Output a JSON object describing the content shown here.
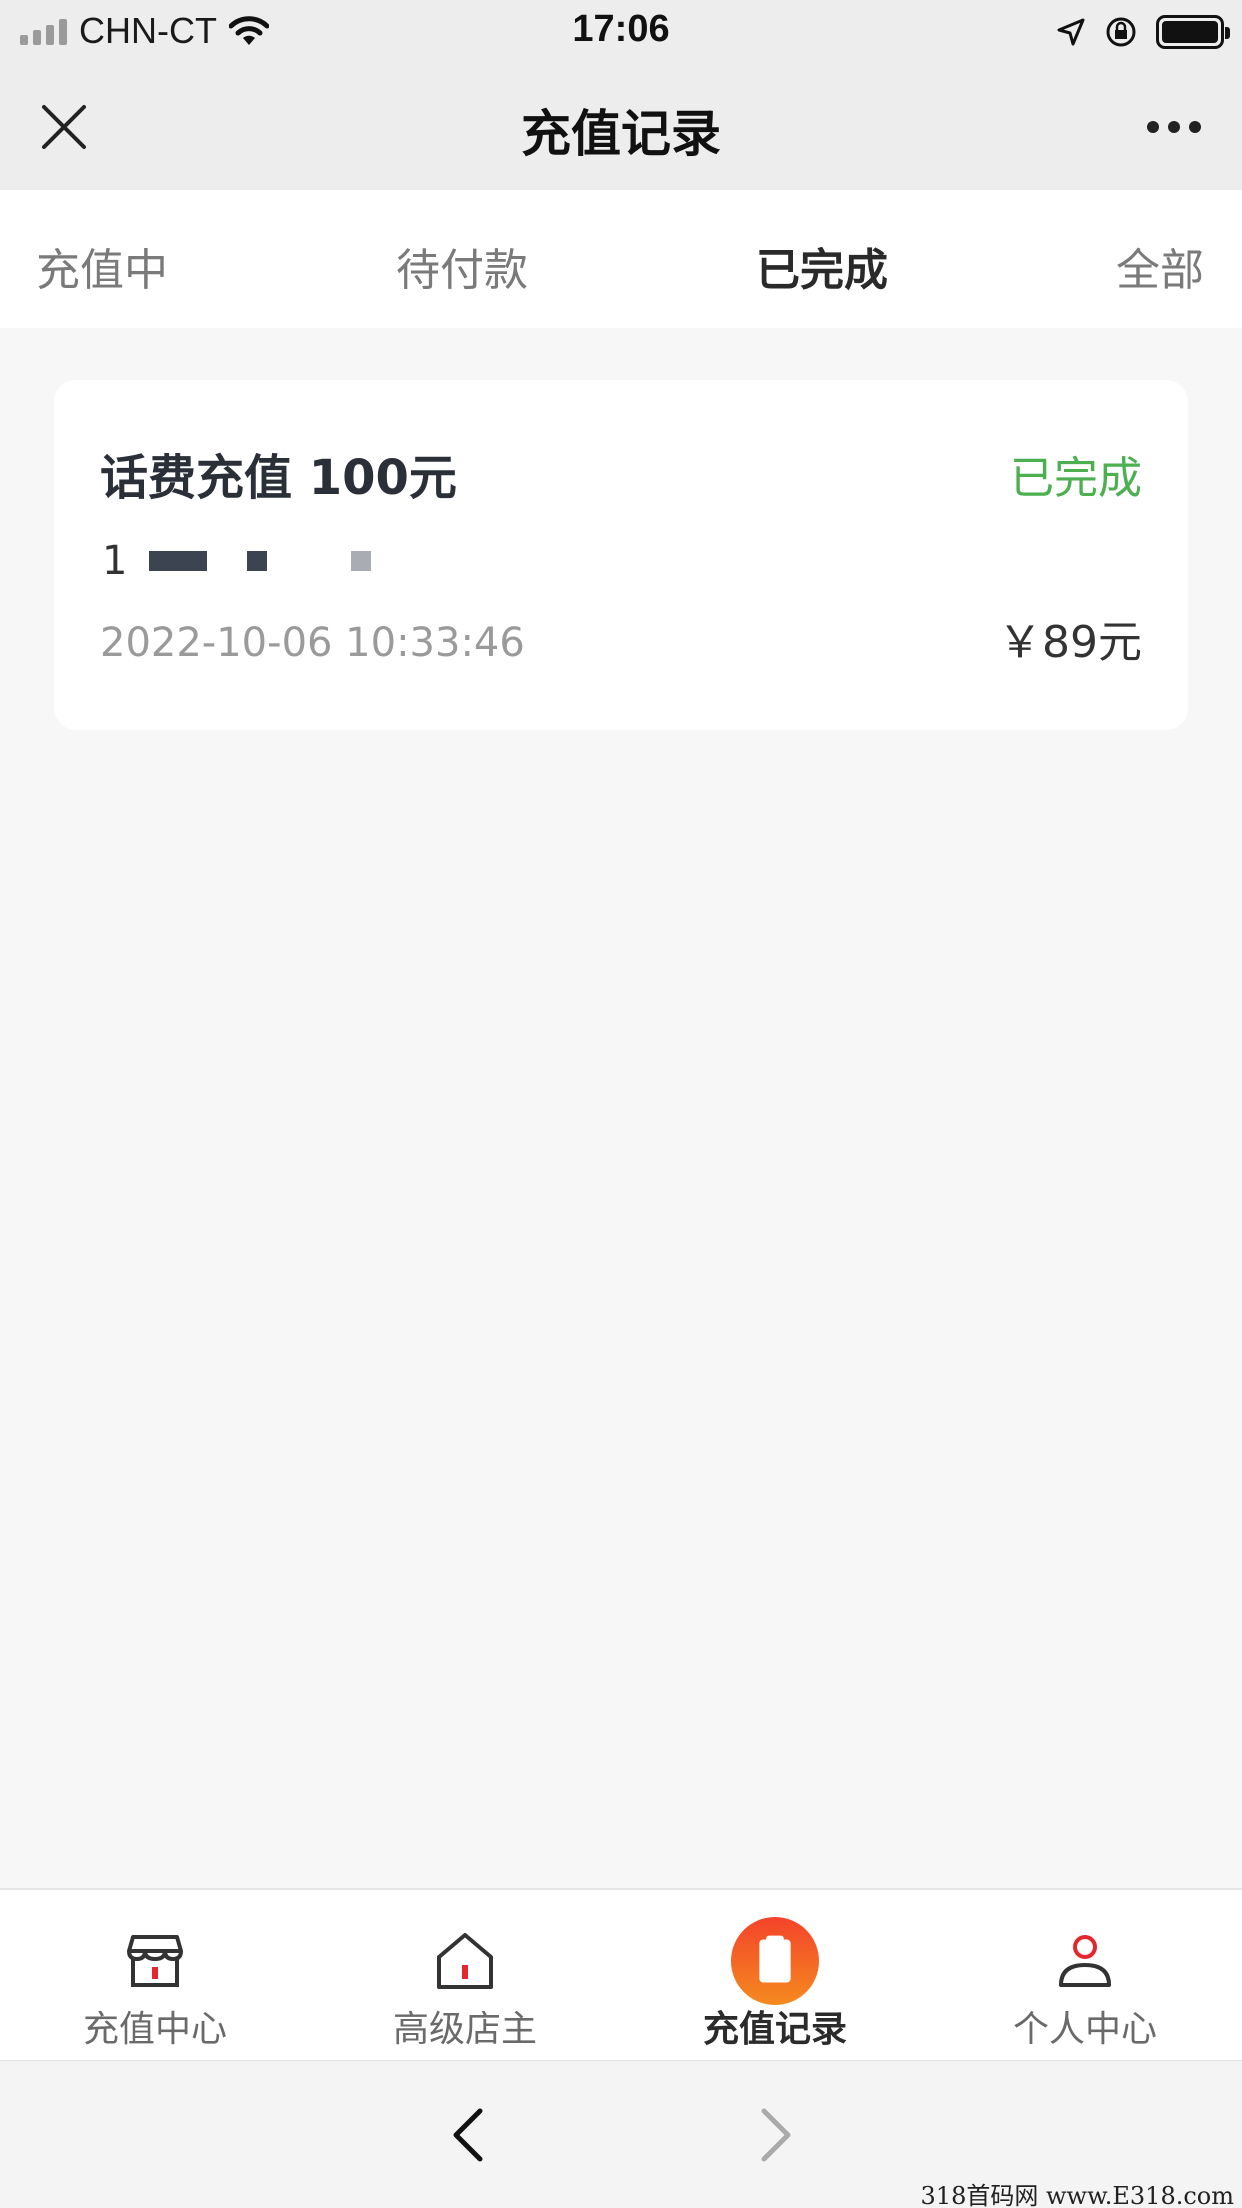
{
  "status_bar": {
    "carrier": "CHN-CT",
    "time": "17:06"
  },
  "nav": {
    "title": "充值记录"
  },
  "tabs": [
    {
      "label": "充值中",
      "active": false
    },
    {
      "label": "待付款",
      "active": false
    },
    {
      "label": "已完成",
      "active": true
    },
    {
      "label": "全部",
      "active": false
    }
  ],
  "order": {
    "title": "话费充值 100元",
    "status": "已完成",
    "phone_prefix": "1",
    "datetime": "2022-10-06 10:33:46",
    "price": "￥89元"
  },
  "bottom_tabs": [
    {
      "label": "充值中心",
      "icon": "store-icon",
      "active": false
    },
    {
      "label": "高级店主",
      "icon": "house-icon",
      "active": false
    },
    {
      "label": "充值记录",
      "icon": "clipboard-icon",
      "active": true
    },
    {
      "label": "个人中心",
      "icon": "person-icon",
      "active": false
    }
  ],
  "watermark": "318首码网 www.E318.com",
  "colors": {
    "status_complete": "#4caf50",
    "accent_orange": "#f25a1f",
    "icon_red": "#e5262d"
  }
}
